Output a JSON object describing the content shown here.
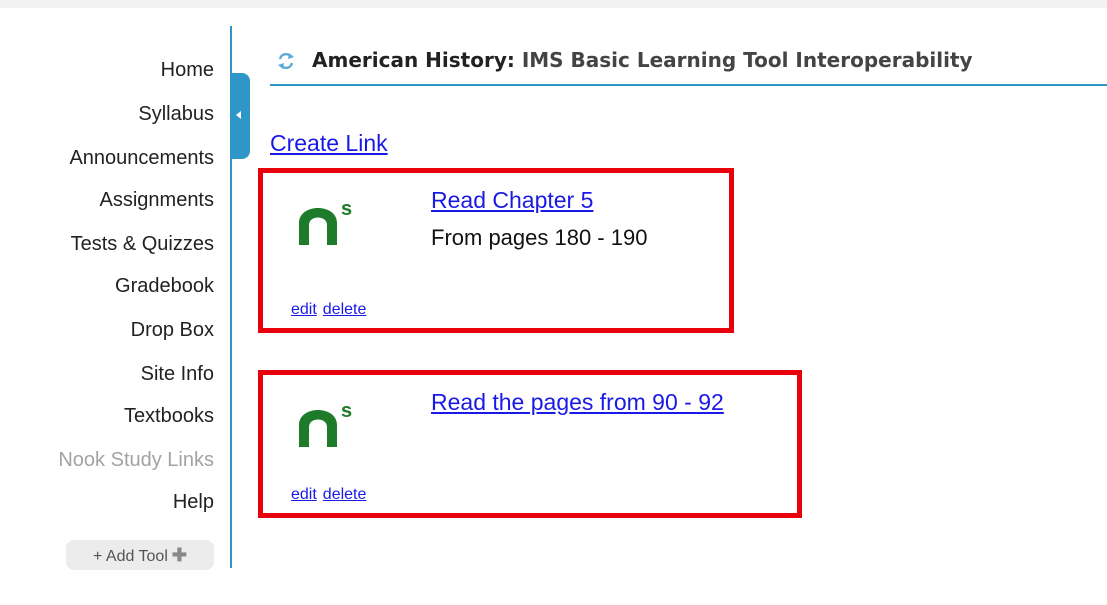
{
  "sidebar": {
    "items": [
      {
        "label": "Home"
      },
      {
        "label": "Syllabus"
      },
      {
        "label": "Announcements"
      },
      {
        "label": "Assignments"
      },
      {
        "label": "Tests & Quizzes"
      },
      {
        "label": "Gradebook"
      },
      {
        "label": "Drop Box"
      },
      {
        "label": "Site Info"
      },
      {
        "label": "Textbooks"
      },
      {
        "label": "Nook Study Links"
      },
      {
        "label": "Help"
      }
    ],
    "add_tool_label": "+ Add Tool"
  },
  "header": {
    "site_name": "American History:",
    "tool_name": "IMS Basic Learning Tool Interoperability"
  },
  "content": {
    "create_link_label": "Create Link",
    "links": [
      {
        "title": "Read Chapter 5",
        "description": "From pages 180 - 190",
        "edit_label": "edit",
        "delete_label": "delete"
      },
      {
        "title": "Read the pages from 90 - 92",
        "description": "",
        "edit_label": "edit",
        "delete_label": "delete"
      }
    ]
  },
  "colors": {
    "accent": "#2f97c8",
    "highlight_box": "#e8000b",
    "link": "#1a1ae6",
    "logo_green": "#1e7b2a"
  },
  "icons": {
    "header": "reset-icon",
    "links": "nook-study-logo-icon",
    "collapse": "collapse-arrow-icon",
    "add_tool": "plus-icon"
  }
}
